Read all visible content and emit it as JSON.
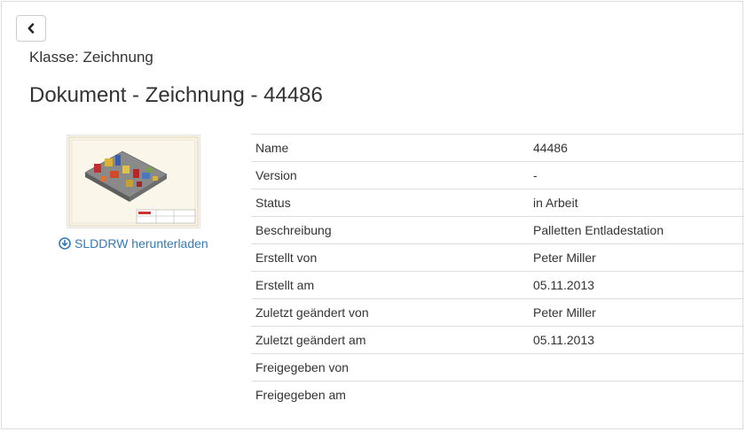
{
  "header": {
    "class_label": "Klasse: Zeichnung",
    "title": "Dokument - Zeichnung - 44486"
  },
  "actions": {
    "back_icon": "chevron-left-icon",
    "download_label": "SLDDRW herunterladen",
    "download_icon": "download-circle-icon"
  },
  "properties": [
    {
      "key": "Name",
      "value": "44486"
    },
    {
      "key": "Version",
      "value": "-"
    },
    {
      "key": "Status",
      "value": "in Arbeit"
    },
    {
      "key": "Beschreibung",
      "value": "Palletten Entladestation"
    },
    {
      "key": "Erstellt von",
      "value": "Peter Miller"
    },
    {
      "key": "Erstellt am",
      "value": "05.11.2013"
    },
    {
      "key": "Zuletzt geändert von",
      "value": "Peter Miller"
    },
    {
      "key": "Zuletzt geändert am",
      "value": "05.11.2013"
    },
    {
      "key": "Freigegeben von",
      "value": ""
    },
    {
      "key": "Freigegeben am",
      "value": ""
    }
  ],
  "colors": {
    "link": "#337ab7",
    "border": "#dddddd",
    "text": "#333333"
  }
}
